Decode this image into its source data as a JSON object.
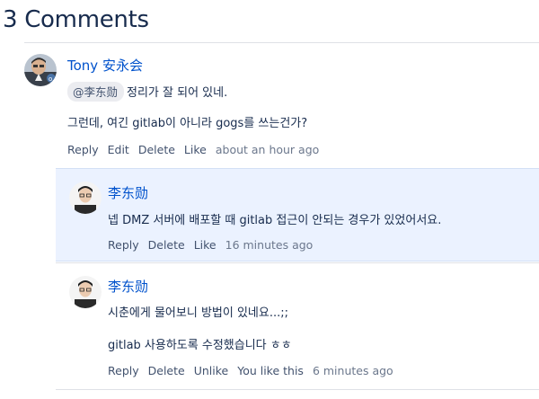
{
  "header": {
    "title": "3 Comments"
  },
  "comments": [
    {
      "author": "Tony 安永会",
      "mention": "@李东勋",
      "lines": [
        "정리가 잘 되어 있네.",
        "그런데, 여긴 gitlab이 아니라 gogs를 쓰는건가?"
      ],
      "actions": [
        "Reply",
        "Edit",
        "Delete",
        "Like"
      ],
      "time": "about an hour ago"
    },
    {
      "author": "李东勋",
      "lines": [
        "넵 DMZ 서버에 배포할 때 gitlab 접근이 안되는 경우가 있었어서요."
      ],
      "actions": [
        "Reply",
        "Delete",
        "Like"
      ],
      "time": "16 minutes ago"
    },
    {
      "author": "李东勋",
      "lines": [
        "시춘에게 물어보니 방법이 있네요...;;",
        "gitlab 사용하도록 수정했습니다 ㅎㅎ"
      ],
      "actions": [
        "Reply",
        "Delete",
        "Unlike"
      ],
      "liked_by": "You like this",
      "time": "6 minutes ago"
    }
  ],
  "colors": {
    "link": "#0052cc",
    "text": "#172b4d",
    "meta": "#42526e",
    "highlight": "#ebf2ff"
  }
}
